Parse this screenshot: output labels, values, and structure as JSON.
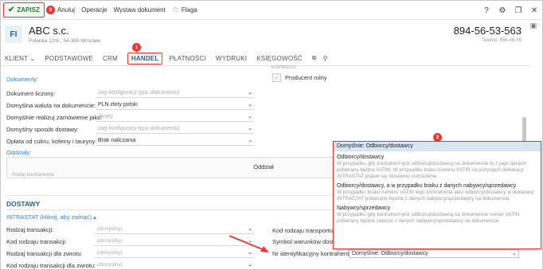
{
  "toolbar": {
    "save_label": "ZAPISZ",
    "save_badge": "3",
    "cancel_label": "Anuluj",
    "operations_label": "Operacje",
    "issue_doc_label": "Wystaw dokument",
    "flag_label": "Flaga",
    "help_label": "?",
    "right_icons": [
      "help-icon",
      "gear-icon",
      "window-restore-icon",
      "close-icon"
    ]
  },
  "header": {
    "avatar": "FI",
    "company_name": "ABC s.c.",
    "address": "Polanka 12/6 , 54-365 Wrocław",
    "phone": "894-56-53-563",
    "phone_label": "Telefon: 456-46-55"
  },
  "tabs": {
    "items": [
      {
        "label": "KLIENT ⌄"
      },
      {
        "label": "PODSTAWOWE"
      },
      {
        "label": "CRM"
      },
      {
        "label": "HANDEL"
      },
      {
        "label": "PŁATNOŚCI"
      },
      {
        "label": "WYDRUKI"
      },
      {
        "label": "KSIĘGOWOŚĆ"
      }
    ],
    "active": "HANDEL",
    "active_badge": "1",
    "hint": "KONTROCIO."
  },
  "documents": {
    "section_label": "Dokumenty:",
    "rows": [
      {
        "label": "Dokument liczony:",
        "value": "(wg konfiguracji typu dokumentu)",
        "placeholder": true
      },
      {
        "label": "Domyślna waluta na dokumencie:",
        "value": "PLN złoty polski",
        "placeholder": false
      },
      {
        "label": "Domyślnie realizuj zamówienie jako:",
        "value": "(brak)",
        "placeholder": true
      },
      {
        "label": "Domyślny sposób dostawy:",
        "value": "(wg konfiguracji typu dokumentu)",
        "placeholder": true
      },
      {
        "label": "Opłata od cukru, kofeiny i tauryny:",
        "value": "Brak naliczania",
        "placeholder": false
      }
    ],
    "producent_label": "Producent rolny"
  },
  "branches": {
    "section_label": "Oddziały:",
    "column_header": "Oddział",
    "placeholder": "Podaj kontrahenta"
  },
  "deliveries": {
    "heading": "DOSTAWY",
    "intrastat_link": "INTRASTAT (kliknij, aby zwinąć) ▴",
    "left_rows": [
      {
        "label": "Rodzaj transakcji:",
        "value": "(domyślny)"
      },
      {
        "label": "Kod rodzaju transakcji:",
        "value": "(domyślny)"
      },
      {
        "label": "Rodzaj transakcji dla zwrotu:",
        "value": "(domyślny)"
      },
      {
        "label": "Kod rodzaju transakcji dla zwrotu:",
        "value": "(domyślny)"
      }
    ],
    "right_rows": [
      {
        "label": "Kod rodzaju transportu:"
      },
      {
        "label": "Symbol warunków dostaw"
      }
    ],
    "nr_label": "Nr identyfikacyjny kontrahenta:",
    "nr_value": "Domyślnie: Odbiorcy/dostawcy"
  },
  "dropdown": {
    "badge": "2",
    "selected": "Domyślnie: Odbiorcy/dostawcy",
    "options": [
      {
        "title": "Odbiorcy/dostawcy",
        "desc": "W przypadku gdy kontrahent jest odbiorcą/dostawcą na dokumencie to z jego danych pobierany będzie VATIN. W przypadku braku numeru VATIN na pozycjach deklaracji INTRASTAT pojawi się stosowne ostrzeżenie."
      },
      {
        "title": "Odbiorcy/dostawcy, a w przypadku braku z danych nabywcy/sprzedawcy",
        "desc": "W przypadku braku numeru VATIN tego kontrahenta jako odbiorcy/dostawcy w deklaracji INTRASTAT pobierane będzie z danych nabywcy/sprzedawcy na dokumencie."
      },
      {
        "title": "Nabywcy/sprzedawcy",
        "desc": "W przypadku gdy kontrahent jest odbiorcą/dostawcą na dokumencie numer VATIN pobierany będzie zawsze z danych nabywcy/sprzedawcy na dokumencie."
      }
    ]
  }
}
